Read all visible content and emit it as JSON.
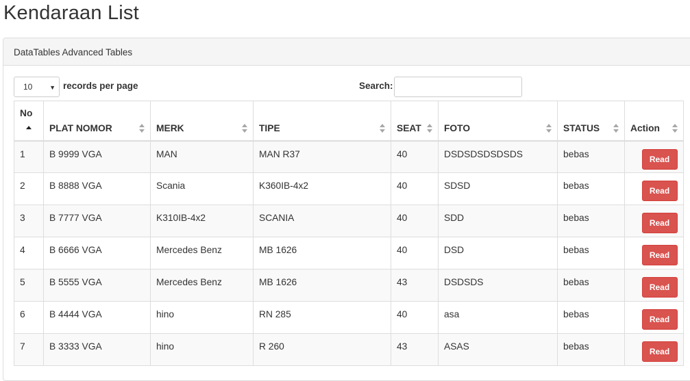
{
  "page": {
    "title": "Kendaraan List"
  },
  "panel": {
    "heading": "DataTables Advanced Tables"
  },
  "controls": {
    "length_value": "10",
    "length_label": "records per page",
    "search_label": "Search:",
    "search_value": ""
  },
  "table": {
    "columns": [
      {
        "label": "No",
        "sort": "asc"
      },
      {
        "label": "PLAT NOMOR",
        "sort": "both"
      },
      {
        "label": "MERK",
        "sort": "both"
      },
      {
        "label": "TIPE",
        "sort": "both"
      },
      {
        "label": "SEAT",
        "sort": "both"
      },
      {
        "label": "FOTO",
        "sort": "both"
      },
      {
        "label": "STATUS",
        "sort": "both"
      },
      {
        "label": "Action",
        "sort": "both"
      }
    ],
    "rows": [
      {
        "no": "1",
        "plat": "B 9999 VGA",
        "merk": "MAN",
        "tipe": "MAN R37",
        "seat": "40",
        "foto": "DSDSDSDSDSDS",
        "status": "bebas",
        "action": "Read"
      },
      {
        "no": "2",
        "plat": "B 8888 VGA",
        "merk": "Scania",
        "tipe": "K360IB-4x2",
        "seat": "40",
        "foto": "SDSD",
        "status": "bebas",
        "action": "Read"
      },
      {
        "no": "3",
        "plat": "B 7777 VGA",
        "merk": "K310IB-4x2",
        "tipe": "SCANIA",
        "seat": "40",
        "foto": "SDD",
        "status": "bebas",
        "action": "Read"
      },
      {
        "no": "4",
        "plat": "B 6666 VGA",
        "merk": "Mercedes Benz",
        "tipe": "MB 1626",
        "seat": "40",
        "foto": "DSD",
        "status": "bebas",
        "action": "Read"
      },
      {
        "no": "5",
        "plat": "B 5555 VGA",
        "merk": "Mercedes Benz",
        "tipe": "MB 1626",
        "seat": "43",
        "foto": "DSDSDS",
        "status": "bebas",
        "action": "Read"
      },
      {
        "no": "6",
        "plat": "B 4444 VGA",
        "merk": "hino",
        "tipe": "RN 285",
        "seat": "40",
        "foto": "asa",
        "status": "bebas",
        "action": "Read"
      },
      {
        "no": "7",
        "plat": "B 3333 VGA",
        "merk": "hino",
        "tipe": "R 260",
        "seat": "43",
        "foto": "ASAS",
        "status": "bebas",
        "action": "Read"
      }
    ]
  },
  "colors": {
    "danger_button": "#d9534f",
    "panel_heading_bg": "#f5f5f5",
    "striped_row_bg": "#f9f9f9"
  }
}
